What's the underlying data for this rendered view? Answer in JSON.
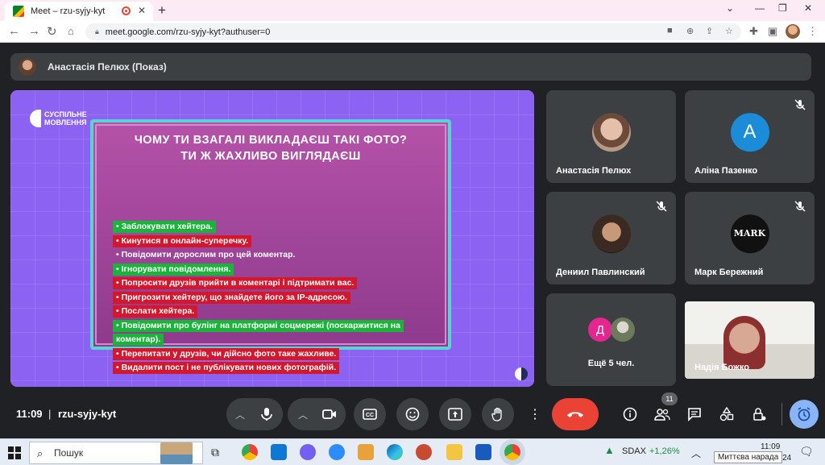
{
  "browser": {
    "tab_title": "Meet – rzu-syjy-kyt",
    "url": "meet.google.com/rzu-syjy-kyt?authuser=0"
  },
  "presenter_bar": {
    "text": "Анастасія Пелюх (Показ)"
  },
  "slide": {
    "logo_line1": "СУСПІЛЬНЕ",
    "logo_line2": "МОВЛЕННЯ",
    "title_line1": "ЧОМУ ТИ ВЗАГАЛІ ВИКЛАДАЄШ ТАКІ ФОТО?",
    "title_line2": "ТИ Ж ЖАХЛИВО ВИГЛЯДАЄШ",
    "options": [
      {
        "text": "• Заблокувати хейтера.",
        "color": "green"
      },
      {
        "text": "• Кинутися в онлайн-суперечку.",
        "color": "red"
      },
      {
        "text": "• Повідомити дорослим про цей коментар.",
        "color": "plain"
      },
      {
        "text": "• Ігнорувати повідомлення.",
        "color": "green"
      },
      {
        "text": "• Попросити друзів прийти в коментарі і підтримати вас.",
        "color": "red"
      },
      {
        "text": "• Пригрозити хейтеру, що знайдете його за IP-адресою.",
        "color": "red"
      },
      {
        "text": "• Послати хейтера.",
        "color": "red"
      },
      {
        "text": "• Повідомити про булінг на платформі соцмережі (поскаржитися на",
        "color": "green"
      },
      {
        "text": "коментар).",
        "color": "green"
      },
      {
        "text": "• Перепитати у друзів, чи дійсно фото таке жахливе.",
        "color": "red"
      },
      {
        "text": "• Видалити пост і не публікувати нових фотографій.",
        "color": "red"
      }
    ]
  },
  "participants": [
    {
      "name": "Анастасія Пелюх"
    },
    {
      "name": "Аліна Пазенко",
      "letter": "A"
    },
    {
      "name": "Дениил Павлинский"
    },
    {
      "name": "Марк Бережний",
      "logo": "MARK"
    },
    {
      "name": "Ещё 5 чел.",
      "letter": "Д"
    },
    {
      "name": "Надія Божко"
    }
  ],
  "controls": {
    "time": "11:09",
    "separator": "|",
    "meeting_code": "rzu-syjy-kyt",
    "participants_count": "11"
  },
  "taskbar": {
    "search_placeholder": "Пошук",
    "stock_name": "SDAX",
    "stock_change": "+1,26%",
    "clock_time": "11:09",
    "clock_year": "2024",
    "tooltip": "Миттєва нарада"
  },
  "colors": {
    "meet_bg": "#202124",
    "tile_bg": "#3c4043",
    "end_call": "#ea4335",
    "slide_bg": "#8b62f2",
    "accent_blue": "#8ab4f8",
    "stock_up": "#1e8e3e"
  }
}
